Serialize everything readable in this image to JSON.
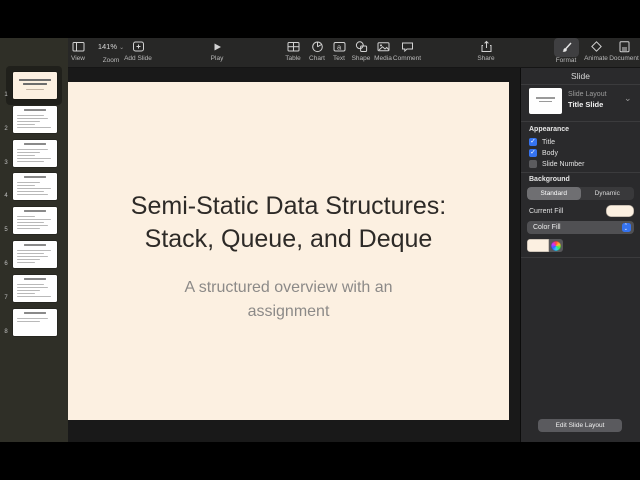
{
  "app": "Keynote",
  "toolbar": {
    "view": {
      "label": "View",
      "icon": "sidebar-icon"
    },
    "zoom": {
      "label": "Zoom",
      "value": "141%"
    },
    "add_slide": {
      "label": "Add Slide",
      "icon": "plus-slide-icon"
    },
    "play": {
      "label": "Play",
      "icon": "play-icon"
    },
    "table": {
      "label": "Table",
      "icon": "table-icon"
    },
    "chart": {
      "label": "Chart",
      "icon": "pie-chart-icon"
    },
    "text": {
      "label": "Text",
      "icon": "text-box-icon"
    },
    "shape": {
      "label": "Shape",
      "icon": "shape-icon"
    },
    "media": {
      "label": "Media",
      "icon": "image-icon"
    },
    "comment": {
      "label": "Comment",
      "icon": "speech-bubble-icon"
    },
    "share": {
      "label": "Share",
      "icon": "share-icon"
    },
    "format": {
      "label": "Format",
      "icon": "paintbrush-icon",
      "selected": true
    },
    "animate": {
      "label": "Animate",
      "icon": "diamond-icon"
    },
    "document": {
      "label": "Document",
      "icon": "document-icon"
    }
  },
  "sidebar": {
    "slides": [
      {
        "number": "1",
        "selected": true,
        "variant": "title"
      },
      {
        "number": "2",
        "selected": false,
        "variant": "bullets"
      },
      {
        "number": "3",
        "selected": false,
        "variant": "bullets"
      },
      {
        "number": "4",
        "selected": false,
        "variant": "bullets"
      },
      {
        "number": "5",
        "selected": false,
        "variant": "bullets"
      },
      {
        "number": "6",
        "selected": false,
        "variant": "bullets"
      },
      {
        "number": "7",
        "selected": false,
        "variant": "bullets"
      },
      {
        "number": "8",
        "selected": false,
        "variant": "short"
      }
    ]
  },
  "slide": {
    "title": "Semi-Static Data Structures: Stack, Queue, and Deque",
    "subtitle": "A structured overview with an assignment",
    "background_color": "#fcf0e1"
  },
  "inspector": {
    "title": "Slide",
    "layout": {
      "label": "Slide Layout",
      "value": "Title Slide"
    },
    "appearance": {
      "heading": "Appearance",
      "title": {
        "label": "Title",
        "checked": true
      },
      "body": {
        "label": "Body",
        "checked": true
      },
      "slide_number": {
        "label": "Slide Number",
        "checked": false
      }
    },
    "background": {
      "heading": "Background",
      "segments": {
        "standard": "Standard",
        "dynamic": "Dynamic"
      },
      "selected": "Standard",
      "current_fill_label": "Current Fill",
      "current_fill_color": "#fcf0e1",
      "color_fill_label": "Color Fill"
    },
    "edit_button": "Edit Slide Layout"
  },
  "colors": {
    "accent_blue": "#3573f0",
    "slide_fill": "#fcf0e1"
  }
}
